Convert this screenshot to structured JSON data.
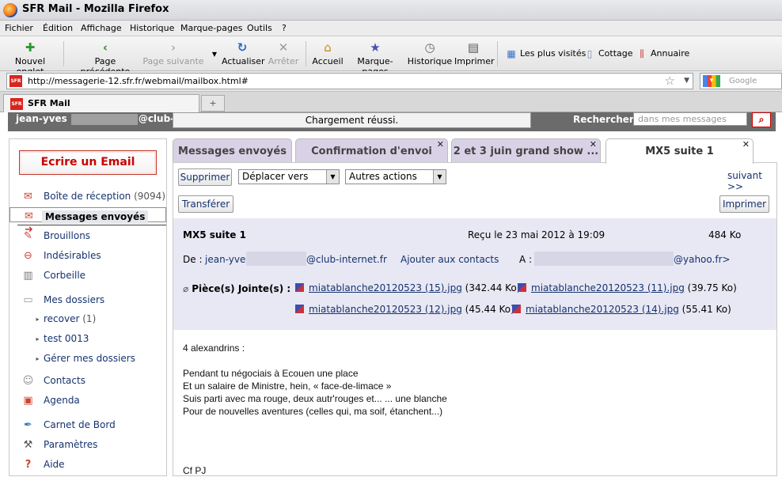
{
  "window": {
    "title": "SFR Mail - Mozilla Firefox"
  },
  "menu": [
    "Fichier",
    "Édition",
    "Affichage",
    "Historique",
    "Marque-pages",
    "Outils",
    "?"
  ],
  "toolbar": {
    "new_tab": "Nouvel onglet",
    "back": "Page précédente",
    "forward": "Page suivante",
    "reload": "Actualiser",
    "stop": "Arrêter",
    "home": "Accueil",
    "bookmarks": "Marque-pages",
    "history": "Historique",
    "print": "Imprimer",
    "bm_most": "Les plus visités",
    "bm_cottage": "Cottage",
    "bm_annuaire": "Annuaire"
  },
  "nav": {
    "url": "http://messagerie-12.sfr.fr/webmail/mailbox.html#",
    "search_placeholder": "Google"
  },
  "browser_tab": {
    "title": "SFR Mail",
    "favicon": "SFR"
  },
  "header": {
    "user_prefix": "jean-yves",
    "user_suffix": "@club-in",
    "status": "Chargement réussi.",
    "search_label": "Rechercher",
    "search_placeholder": "dans mes messages"
  },
  "sidebar": {
    "compose": "Ecrire un Email",
    "items": [
      {
        "label": "Boîte de réception",
        "count": "(9094)",
        "icon": "inbox-icon"
      },
      {
        "label": "Messages envoyés",
        "icon": "sent-icon",
        "selected": true
      },
      {
        "label": "Brouillons",
        "icon": "drafts-icon"
      },
      {
        "label": "Indésirables",
        "icon": "spam-icon"
      },
      {
        "label": "Corbeille",
        "icon": "trash-icon"
      },
      {
        "label": "Mes dossiers",
        "icon": "folder-icon"
      },
      {
        "label": "recover",
        "count": "(1)",
        "icon": "bullet-icon"
      },
      {
        "label": "test 0013",
        "icon": "bullet-icon"
      },
      {
        "label": "Gérer mes dossiers",
        "icon": "bullet-icon"
      },
      {
        "label": "Contacts",
        "icon": "contacts-icon"
      },
      {
        "label": "Agenda",
        "icon": "calendar-icon"
      },
      {
        "label": "Carnet de Bord",
        "icon": "feather-icon"
      },
      {
        "label": "Paramètres",
        "icon": "wrench-icon"
      },
      {
        "label": "Aide",
        "icon": "help-icon"
      }
    ]
  },
  "tabs": [
    {
      "label": "Messages envoyés"
    },
    {
      "label": "Confirmation d'envoi"
    },
    {
      "label": "2 et 3 juin grand show ..."
    },
    {
      "label": "MX5 suite 1"
    }
  ],
  "actions": {
    "delete": "Supprimer",
    "move": "Déplacer vers",
    "other": "Autres actions",
    "next": "suivant >>",
    "forward": "Transférer",
    "print": "Imprimer"
  },
  "message": {
    "subject": "MX5 suite 1",
    "received": "Reçu le 23 mai 2012 à 19:09",
    "size": "484 Ko",
    "from_label": "De :",
    "from_prefix": "jean-yves",
    "from_suffix": "@club-internet.fr",
    "add_contact": "Ajouter aux contacts",
    "to_label": "A :",
    "to_suffix": "@yahoo.fr>",
    "attachments_label": "Pièce(s) Jointe(s) :",
    "attachments": [
      {
        "name": "miatablanche20120523 (15).jpg",
        "size": "(342.44 Ko)"
      },
      {
        "name": "miatablanche20120523 (11).jpg",
        "size": "(39.75 Ko)"
      },
      {
        "name": "miatablanche20120523 (12).jpg",
        "size": "(45.44 Ko)"
      },
      {
        "name": "miatablanche20120523 (14).jpg",
        "size": "(55.41 Ko)"
      }
    ],
    "body": [
      "4 alexandrins :",
      "",
      "Pendant tu négociais à Ecouen une place",
      "Et un salaire de Ministre, hein, « face-de-limace »",
      "Suis parti avec ma rouge, deux autr'rouges et... ... une blanche",
      "Pour de nouvelles aventures (celles qui, ma soif, étanchent...)",
      "",
      "",
      "",
      "",
      "Cf PJ"
    ]
  }
}
